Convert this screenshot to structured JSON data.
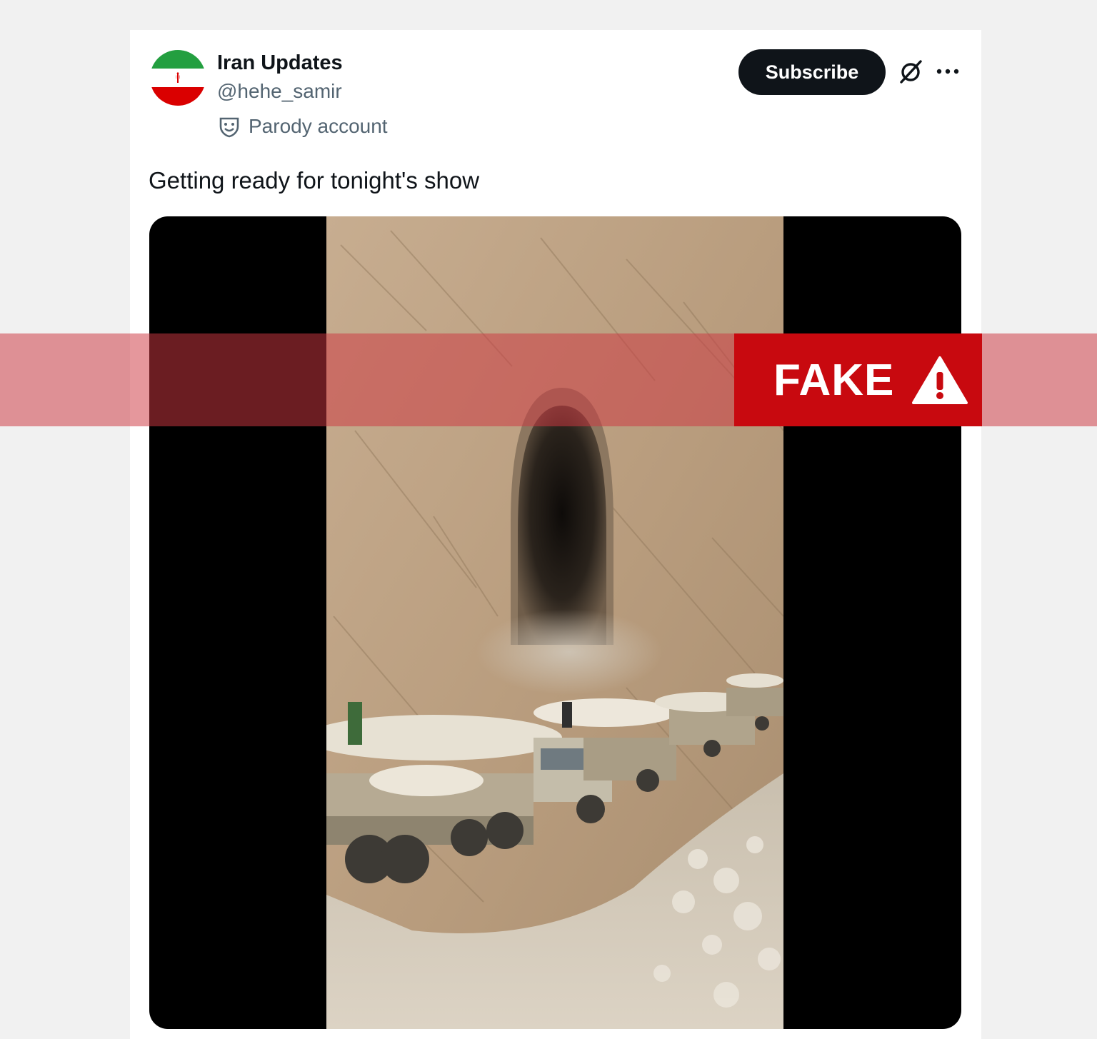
{
  "post": {
    "display_name": "Iran Updates",
    "handle": "@hehe_samir",
    "badge_label": "Parody account",
    "text": "Getting ready for tonight's show",
    "avatar_icon": "iran-flag-icon",
    "avatar_colors": [
      "#239f40",
      "#ffffff",
      "#da0000"
    ]
  },
  "actions": {
    "subscribe_label": "Subscribe",
    "grok_icon": "grok-icon",
    "more_icon": "more-options-icon"
  },
  "media": {
    "type": "video",
    "content": "convoy of missile trucks at a mountain tunnel"
  },
  "overlay": {
    "label": "FAKE",
    "icon": "warning-triangle-icon",
    "color": "#c8090f"
  }
}
